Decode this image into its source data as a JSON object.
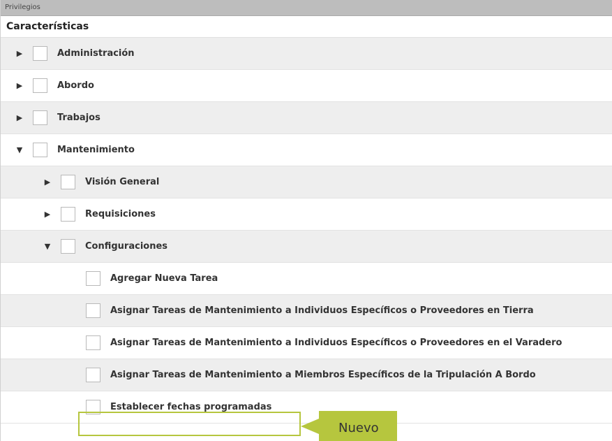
{
  "panel": {
    "header": "Privilegios",
    "section_title": "Características"
  },
  "rows": [
    {
      "label": "Administración",
      "toggle": "▶"
    },
    {
      "label": "Abordo",
      "toggle": "▶"
    },
    {
      "label": "Trabajos",
      "toggle": "▶"
    },
    {
      "label": "Mantenimiento",
      "toggle": "▼"
    },
    {
      "label": "Visión General",
      "toggle": "▶"
    },
    {
      "label": "Requisiciones",
      "toggle": "▶"
    },
    {
      "label": "Configuraciones",
      "toggle": "▼"
    },
    {
      "label": "Agregar Nueva Tarea"
    },
    {
      "label": "Asignar Tareas de Mantenimiento a Individuos Específicos o Proveedores en Tierra"
    },
    {
      "label": "Asignar Tareas de Mantenimiento a Individuos Específicos o Proveedores en el Varadero"
    },
    {
      "label": "Asignar Tareas de Mantenimiento a Miembros Específicos de la Tripulación A Bordo"
    },
    {
      "label": "Establecer fechas programadas"
    }
  ],
  "callout": {
    "text": "Nuevo",
    "color": "#b6c63e"
  },
  "colors": {
    "header_bg": "#bdbdbd",
    "row_alt_bg": "#eeeeee",
    "highlight": "#b6c63e"
  }
}
